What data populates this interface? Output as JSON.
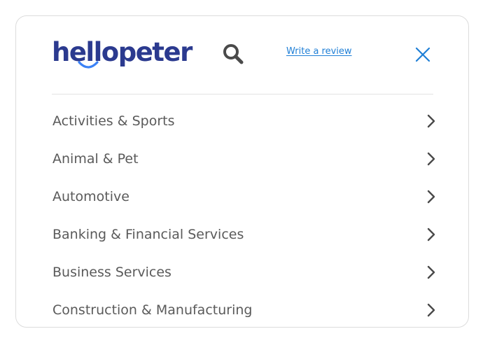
{
  "header": {
    "logo_text": "hellopeter",
    "write_review_label": "Write a review",
    "icons": {
      "search": "search-icon",
      "close": "close-icon",
      "chevron": "chevron-right-icon"
    }
  },
  "menu": {
    "items": [
      {
        "label": "Activities & Sports"
      },
      {
        "label": "Animal & Pet"
      },
      {
        "label": "Automotive"
      },
      {
        "label": "Banking & Financial Services"
      },
      {
        "label": "Business Services"
      },
      {
        "label": "Construction & Manufacturing"
      }
    ]
  },
  "colors": {
    "brand_navy": "#2b3a8f",
    "link_blue": "#1f7fd6",
    "smile_blue": "#3b82f6",
    "text_gray": "#5a5a5a",
    "icon_gray": "#4a4a4a"
  }
}
